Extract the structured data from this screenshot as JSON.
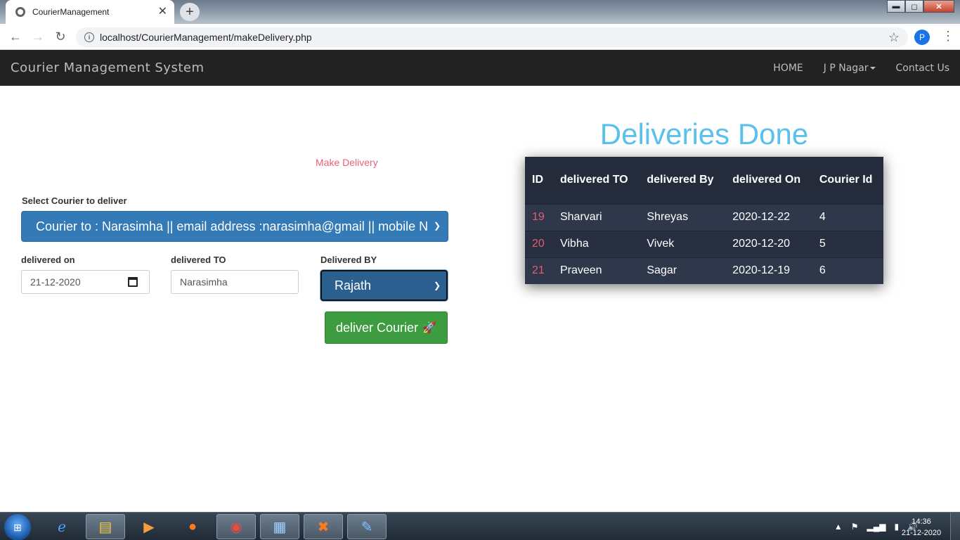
{
  "browser": {
    "tab_title": "CourierManagement",
    "tab_close": "✕",
    "new_tab": "+",
    "url": "localhost/CourierManagement/makeDelivery.php",
    "profile_initial": "P",
    "window_controls": {
      "minimize": "▬",
      "maximize": "◻",
      "close": "✕"
    }
  },
  "navbar": {
    "brand": "Courier Management System",
    "links": {
      "home": "HOME",
      "branch": "J P Nagar",
      "contact": "Contact Us"
    }
  },
  "form": {
    "heading": "Make Delivery",
    "select_courier_label": "Select Courier to deliver",
    "select_courier_value": "Courier to : Narasimha || email address :narasimha@gmail || mobile N",
    "delivered_on_label": "delivered on",
    "delivered_on_value": "21-12-2020",
    "delivered_to_label": "delivered TO",
    "delivered_to_value": "Narasimha",
    "delivered_by_label": "Delivered BY",
    "delivered_by_value": "Rajath",
    "submit_label": "deliver Courier"
  },
  "deliveries": {
    "title": "Deliveries Done",
    "columns": [
      "ID",
      "delivered TO",
      "delivered By",
      "delivered On",
      "Courier Id"
    ],
    "rows": [
      {
        "id": "19",
        "to": "Sharvari",
        "by": "Shreyas",
        "on": "2020-12-22",
        "courier_id": "4"
      },
      {
        "id": "20",
        "to": "Vibha",
        "by": "Vivek",
        "on": "2020-12-20",
        "courier_id": "5"
      },
      {
        "id": "21",
        "to": "Praveen",
        "by": "Sagar",
        "on": "2020-12-19",
        "courier_id": "6"
      }
    ]
  },
  "taskbar": {
    "time": "14:36",
    "date": "21-12-2020",
    "apps": [
      "internet-explorer-icon",
      "file-explorer-icon",
      "media-player-icon",
      "firefox-icon",
      "chrome-icon",
      "control-panel-icon",
      "xampp-icon",
      "paint-icon"
    ]
  },
  "colors": {
    "navbar_bg": "#222222",
    "title_accent": "#5bc0eb",
    "link_pink": "#e8627c",
    "select_blue": "#337ab7",
    "button_green": "#3c9c3f",
    "table_bg": "#2c3446"
  }
}
